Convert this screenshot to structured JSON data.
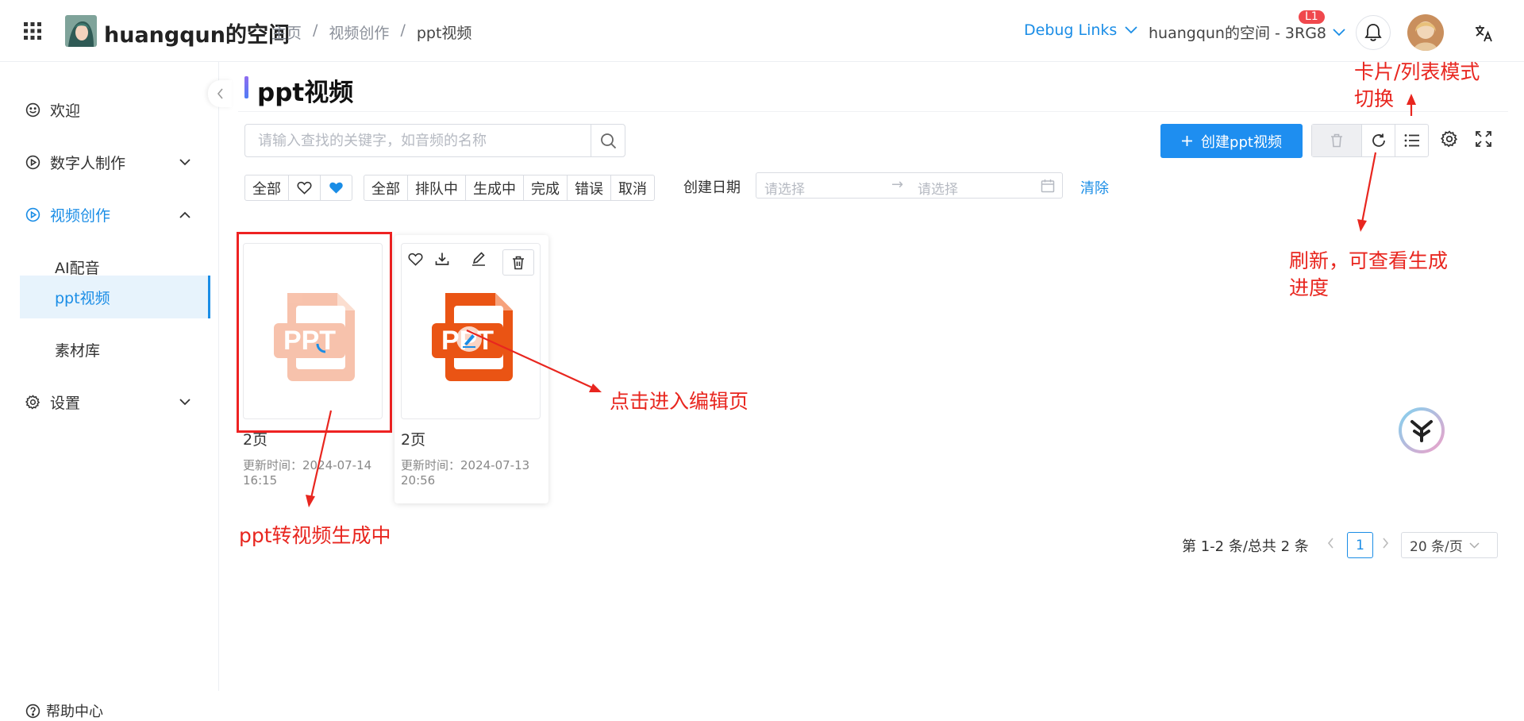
{
  "header": {
    "space_title": "huangqun的空间",
    "breadcrumb": [
      "主页",
      "/",
      "视频创作",
      "/",
      "ppt视频"
    ],
    "debug_links": "Debug Links",
    "space_switch": "huangqun的空间 - 3RG8",
    "level_badge": "L1"
  },
  "sidebar": {
    "items": [
      {
        "label": "欢迎"
      },
      {
        "label": "数字人制作"
      },
      {
        "label": "视频创作"
      },
      {
        "label": "AI配音"
      },
      {
        "label": "ppt视频"
      },
      {
        "label": "素材库"
      },
      {
        "label": "设置"
      }
    ],
    "help": "帮助中心"
  },
  "main": {
    "title": "ppt视频",
    "search_placeholder": "请输入查找的关键字，如音频的名称",
    "create_label": "创建ppt视频",
    "fav_filter": {
      "all": "全部"
    },
    "status_filter": [
      "全部",
      "排队中",
      "生成中",
      "完成",
      "错误",
      "取消"
    ],
    "date_label": "创建日期",
    "date_start_placeholder": "请选择",
    "date_arrow": "→",
    "date_end_placeholder": "请选择",
    "clear_label": "清除"
  },
  "cards": [
    {
      "pages": "2页",
      "time_label": "更新时间：2024-07-14",
      "time_hm": "16:15",
      "thumb_text": "PPT",
      "status": "generating"
    },
    {
      "pages": "2页",
      "time_label": "更新时间：2024-07-13",
      "time_hm": "20:56",
      "thumb_text": "PPT",
      "status": "done"
    }
  ],
  "pagination": {
    "total": "第 1-2 条/总共 2 条",
    "current": "1",
    "page_size": "20 条/页"
  },
  "annotations": {
    "toggle_line1": "卡片/列表模式",
    "toggle_line2": "切换",
    "refresh_line1": "刷新，可查看生成",
    "refresh_line2": "进度",
    "edit": "点击进入编辑页",
    "generating": "ppt转视频生成中"
  },
  "colors": {
    "accent": "#1a8de6",
    "primary_button": "#1e8ef0",
    "annotation": "#e8261f",
    "ppt_orange": "#ea5414",
    "badge": "#f0484d"
  }
}
